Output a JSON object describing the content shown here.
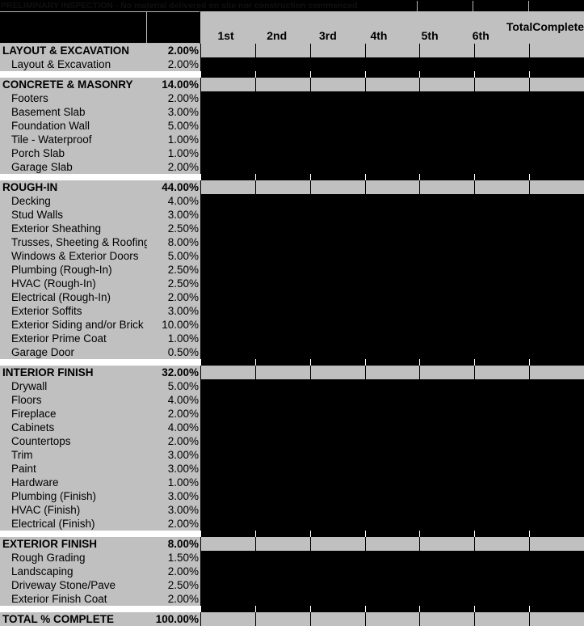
{
  "banner": {
    "note": "PRELIMINARY INSPECTION - No material delivered on site nor construction commenced",
    "empty_cells": [
      "",
      "",
      ""
    ]
  },
  "header": {
    "blank_description": "",
    "blank_percent": "",
    "draw_columns": [
      "1st",
      "2nd",
      "3rd",
      "4th",
      "5th",
      "6th"
    ],
    "total_column_line1": "Total",
    "total_column_line2": "Complete"
  },
  "colors": {
    "gray": "#c0c0c0",
    "black": "#000000",
    "white": "#ffffff"
  },
  "sections": [
    {
      "name": "LAYOUT & EXCAVATION",
      "percent": "2.00%",
      "items": [
        {
          "name": "Layout & Excavation",
          "percent": "2.00%"
        }
      ]
    },
    {
      "name": "CONCRETE & MASONRY",
      "percent": "14.00%",
      "items": [
        {
          "name": "Footers",
          "percent": "2.00%"
        },
        {
          "name": "Basement Slab",
          "percent": "3.00%"
        },
        {
          "name": "Foundation Wall",
          "percent": "5.00%"
        },
        {
          "name": "Tile - Waterproof",
          "percent": "1.00%"
        },
        {
          "name": "Porch Slab",
          "percent": "1.00%"
        },
        {
          "name": "Garage Slab",
          "percent": "2.00%"
        }
      ]
    },
    {
      "name": "ROUGH-IN",
      "percent": "44.00%",
      "items": [
        {
          "name": "Decking",
          "percent": "4.00%"
        },
        {
          "name": "Stud Walls",
          "percent": "3.00%"
        },
        {
          "name": "Exterior Sheathing",
          "percent": "2.50%"
        },
        {
          "name": "Trusses, Sheeting & Roofing",
          "percent": "8.00%"
        },
        {
          "name": "Windows & Exterior Doors",
          "percent": "5.00%"
        },
        {
          "name": "Plumbing (Rough-In)",
          "percent": "2.50%"
        },
        {
          "name": "HVAC (Rough-In)",
          "percent": "2.50%"
        },
        {
          "name": "Electrical (Rough-In)",
          "percent": "2.00%"
        },
        {
          "name": "Exterior Soffits",
          "percent": "3.00%"
        },
        {
          "name": "Exterior Siding and/or Brick",
          "percent": "10.00%"
        },
        {
          "name": "Exterior Prime Coat",
          "percent": "1.00%"
        },
        {
          "name": "Garage Door",
          "percent": "0.50%"
        }
      ]
    },
    {
      "name": "INTERIOR FINISH",
      "percent": "32.00%",
      "items": [
        {
          "name": "Drywall",
          "percent": "5.00%"
        },
        {
          "name": "Floors",
          "percent": "4.00%"
        },
        {
          "name": "Fireplace",
          "percent": "2.00%"
        },
        {
          "name": "Cabinets",
          "percent": "4.00%"
        },
        {
          "name": "Countertops",
          "percent": "2.00%"
        },
        {
          "name": "Trim",
          "percent": "3.00%"
        },
        {
          "name": "Paint",
          "percent": "3.00%"
        },
        {
          "name": "Hardware",
          "percent": "1.00%"
        },
        {
          "name": "Plumbing (Finish)",
          "percent": "3.00%"
        },
        {
          "name": "HVAC (Finish)",
          "percent": "3.00%"
        },
        {
          "name": "Electrical (Finish)",
          "percent": "2.00%"
        }
      ]
    },
    {
      "name": "EXTERIOR FINISH",
      "percent": "8.00%",
      "items": [
        {
          "name": "Rough Grading",
          "percent": "1.50%"
        },
        {
          "name": "Landscaping",
          "percent": "2.00%"
        },
        {
          "name": "Driveway Stone/Pave",
          "percent": "2.50%"
        },
        {
          "name": "Exterior Finish Coat",
          "percent": "2.00%"
        }
      ]
    }
  ],
  "total": {
    "label": "TOTAL % COMPLETE",
    "percent": "100.00%"
  }
}
